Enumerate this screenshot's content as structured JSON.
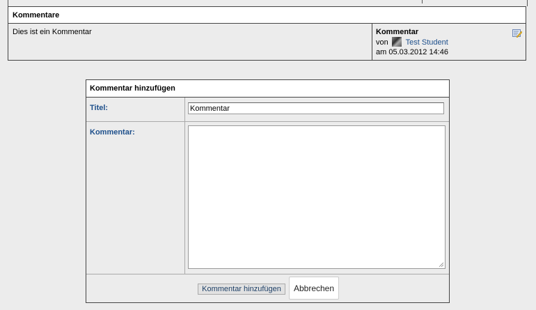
{
  "comments_panel": {
    "heading": "Kommentare",
    "comment": {
      "text": "Dies ist ein Kommentar",
      "title": "Kommentar",
      "by_prefix": "von",
      "author": "Test Student",
      "date": "am 05.03.2012 14:46",
      "edit_icon": "edit-note-icon"
    }
  },
  "add_comment_form": {
    "heading": "Kommentar hinzufügen",
    "title_label": "Titel:",
    "title_value": "Kommentar",
    "comment_label": "Kommentar:",
    "comment_value": "",
    "submit_label": "Kommentar hinzufügen",
    "cancel_label": "Abbrechen"
  },
  "colors": {
    "label_blue": "#1d4f8b",
    "background": "#ececec",
    "border": "#444444"
  }
}
